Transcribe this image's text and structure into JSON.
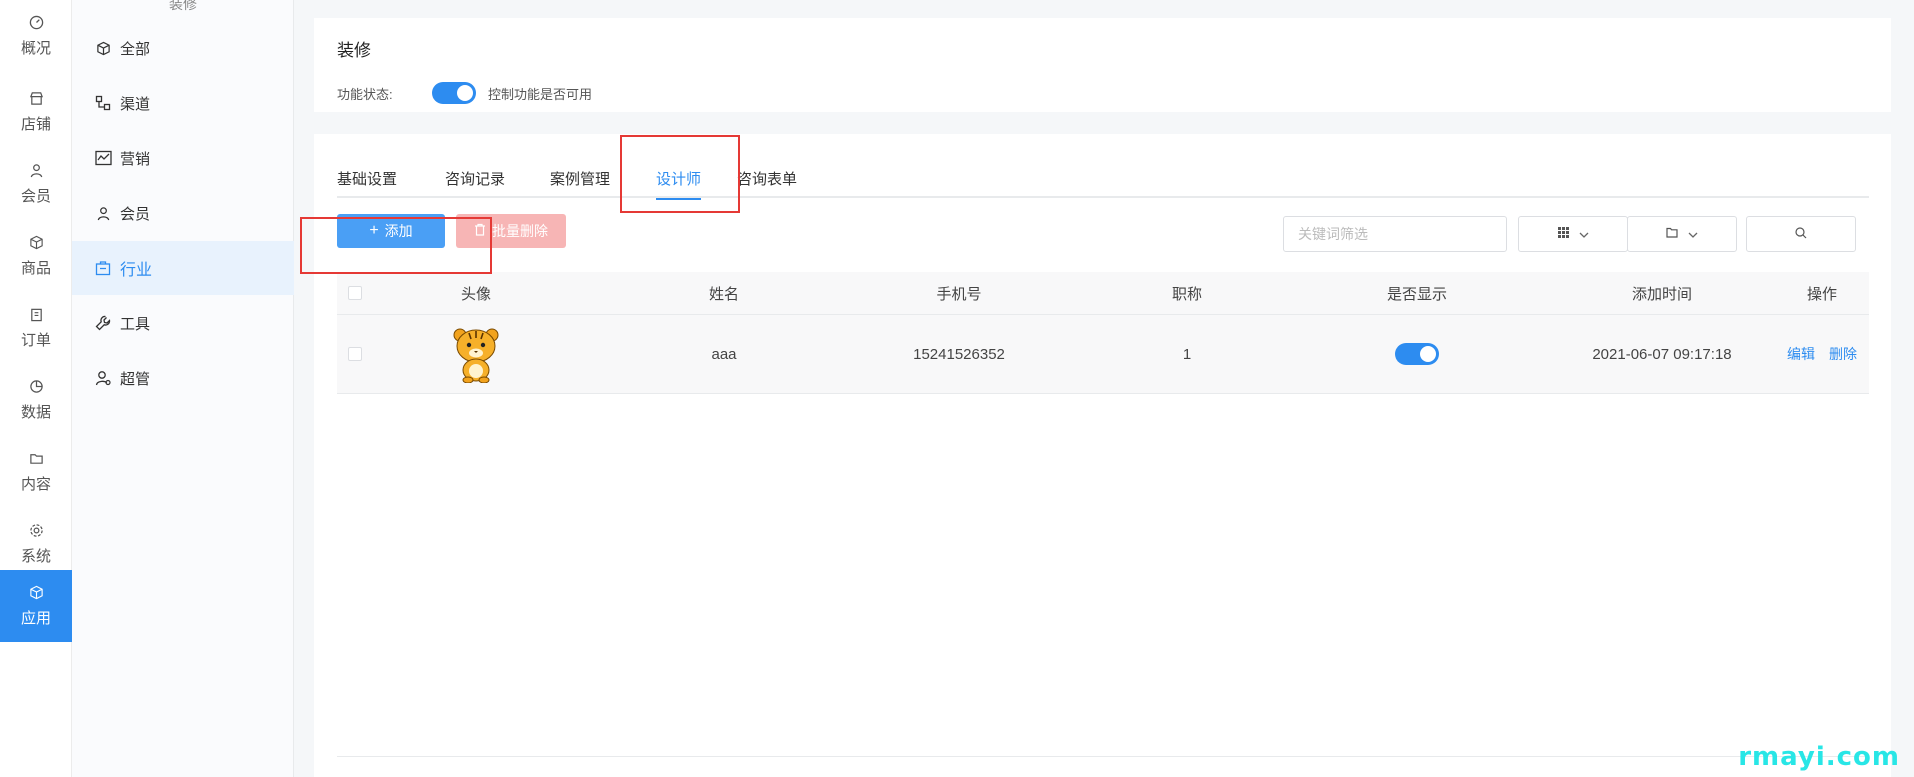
{
  "rail": {
    "items": [
      {
        "label": "概况",
        "icon": "dashboard-icon"
      },
      {
        "label": "店铺",
        "icon": "store-icon"
      },
      {
        "label": "会员",
        "icon": "user-icon"
      },
      {
        "label": "商品",
        "icon": "box-icon"
      },
      {
        "label": "订单",
        "icon": "clipboard-icon"
      },
      {
        "label": "数据",
        "icon": "pie-icon"
      },
      {
        "label": "内容",
        "icon": "folder-icon"
      },
      {
        "label": "系统",
        "icon": "gear-icon"
      },
      {
        "label": "应用",
        "icon": "cube-icon"
      }
    ]
  },
  "subnav": {
    "top_label": "装修",
    "items": [
      {
        "label": "全部",
        "icon": "cube-icon"
      },
      {
        "label": "渠道",
        "icon": "channel-icon"
      },
      {
        "label": "营销",
        "icon": "chart-icon"
      },
      {
        "label": "会员",
        "icon": "user-icon"
      },
      {
        "label": "行业",
        "icon": "industry-icon"
      },
      {
        "label": "工具",
        "icon": "wrench-icon"
      },
      {
        "label": "超管",
        "icon": "admin-icon"
      }
    ]
  },
  "header": {
    "title": "装修",
    "status_label": "功能状态:",
    "status_desc": "控制功能是否可用"
  },
  "tabs": [
    "基础设置",
    "咨询记录",
    "案例管理",
    "设计师",
    "咨询表单"
  ],
  "toolbar": {
    "add_label": "添加",
    "delete_label": "批量删除",
    "search_placeholder": "关键词筛选"
  },
  "table": {
    "headers": [
      "头像",
      "姓名",
      "手机号",
      "职称",
      "是否显示",
      "添加时间",
      "操作"
    ],
    "rows": [
      {
        "name": "aaa",
        "phone": "15241526352",
        "title": "1",
        "visible": true,
        "added": "2021-06-07 09:17:18",
        "edit": "编辑",
        "delete": "删除"
      }
    ]
  },
  "watermark": "rmayi.com",
  "colors": {
    "accent": "#2d8cf0",
    "danger_light": "#f7b5b5",
    "annotation": "#e53935"
  }
}
